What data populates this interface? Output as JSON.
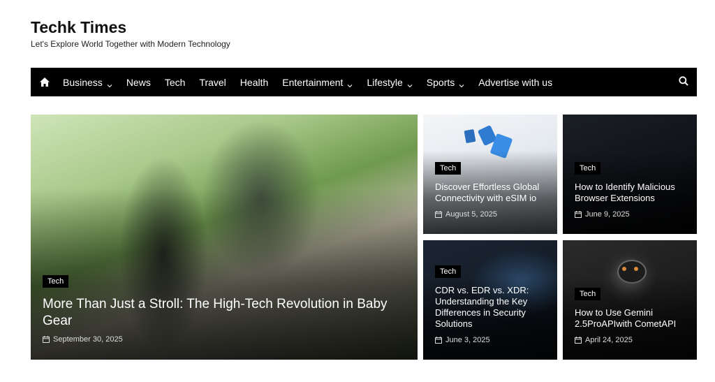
{
  "site": {
    "title": "Techk Times",
    "tagline": "Let's Explore World Together with Modern Technology"
  },
  "nav": {
    "home_icon": "home-icon",
    "items": [
      {
        "label": "Business",
        "dropdown": true
      },
      {
        "label": "News",
        "dropdown": false
      },
      {
        "label": "Tech",
        "dropdown": false
      },
      {
        "label": "Travel",
        "dropdown": false
      },
      {
        "label": "Health",
        "dropdown": false
      },
      {
        "label": "Entertainment",
        "dropdown": true
      },
      {
        "label": "Lifestyle",
        "dropdown": true
      },
      {
        "label": "Sports",
        "dropdown": true
      },
      {
        "label": "Advertise with us",
        "dropdown": false
      }
    ],
    "search_icon": "search-icon"
  },
  "featured": {
    "category": "Tech",
    "title": "More Than Just a Stroll: The High-Tech Revolution in Baby Gear",
    "date": "September 30, 2025"
  },
  "cards": [
    {
      "category": "Tech",
      "title": "Discover Effortless Global Connectivity with eSIM io",
      "date": "August 5, 2025"
    },
    {
      "category": "Tech",
      "title": "How to Identify Malicious Browser Extensions",
      "date": "June 9, 2025"
    },
    {
      "category": "Tech",
      "title": "CDR vs. EDR vs. XDR: Understanding the Key Differences in Security Solutions",
      "date": "June 3, 2025"
    },
    {
      "category": "Tech",
      "title": "How to Use Gemini 2.5ProAPIwith CometAPI",
      "date": "April 24, 2025"
    }
  ],
  "colors": {
    "nav_bg": "#000000",
    "badge_bg": "#000000",
    "text_dark": "#111111"
  }
}
